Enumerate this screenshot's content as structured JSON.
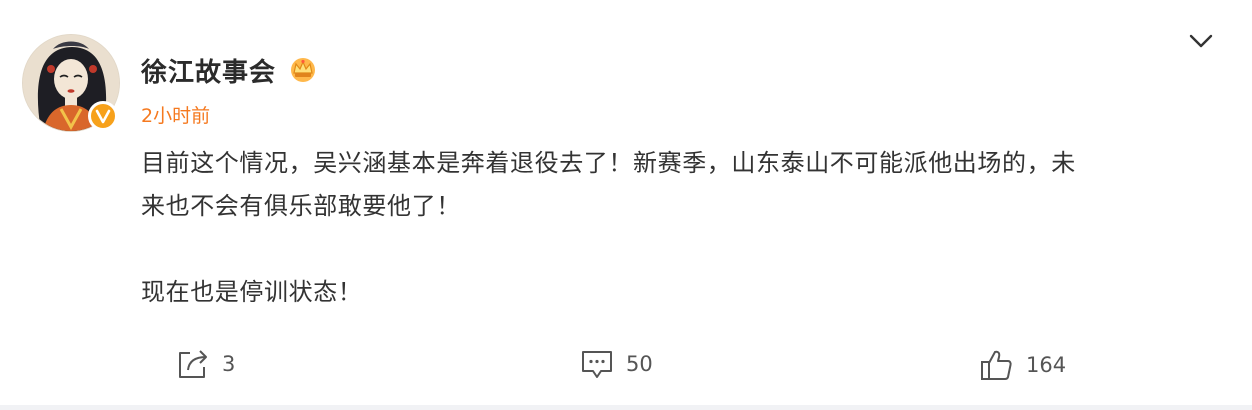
{
  "post": {
    "author": "徐江故事会",
    "time": "2小时前",
    "content_line1": "目前这个情况，吴兴涵基本是奔着退役去了！新赛季，山东泰山不可能派他出场的，未",
    "content_line2": "来也不会有俱乐部敢要他了！",
    "content_line3": "现在也是停训状态！"
  },
  "actions": {
    "share_count": "3",
    "comment_count": "50",
    "like_count": "164"
  },
  "colors": {
    "time": "#f5791f",
    "verified_badge": "#f7a11b",
    "text": "#333333"
  }
}
